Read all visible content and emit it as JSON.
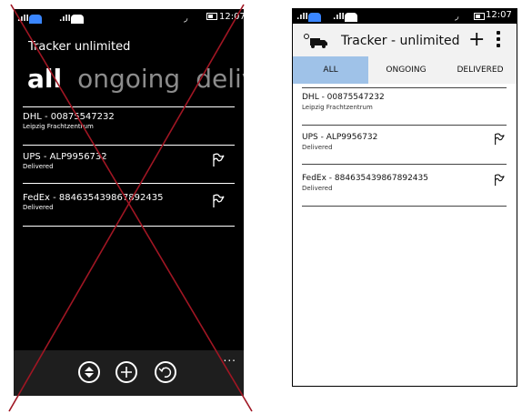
{
  "left_phone": {
    "status": {
      "time": "12:07"
    },
    "title": "Tracker unlimited",
    "pivot": [
      "all",
      "ongoing",
      "deliv"
    ],
    "items": [
      {
        "title": "DHL - 00875547232",
        "subtitle": "Leipzig Frachtzentrum",
        "flag": false
      },
      {
        "title": "UPS - ALP9956732",
        "subtitle": "Delivered",
        "flag": true
      },
      {
        "title": "FedEx - 884635439867892435",
        "subtitle": "Delivered",
        "flag": true
      }
    ],
    "appbar": {
      "icons": [
        "sort-icon",
        "add-icon",
        "refresh-icon"
      ],
      "more": "..."
    }
  },
  "right_phone": {
    "status": {
      "time": "12:07"
    },
    "title": "Tracker - unlimited",
    "add_label": "+",
    "tabs": [
      {
        "label": "ALL",
        "selected": true
      },
      {
        "label": "ONGOING",
        "selected": false
      },
      {
        "label": "DELIVERED",
        "selected": false
      }
    ],
    "items": [
      {
        "title": "DHL - 00875547232",
        "subtitle": "Leipzig Frachtzentrum",
        "flag": false
      },
      {
        "title": "UPS - ALP9956732",
        "subtitle": "Delivered",
        "flag": true
      },
      {
        "title": "FedEx - 884635439867892435",
        "subtitle": "Delivered",
        "flag": true
      }
    ]
  },
  "colors": {
    "cross": "#a01623",
    "tab_selected": "#9fc2e8",
    "signal": "#3a86ff"
  }
}
